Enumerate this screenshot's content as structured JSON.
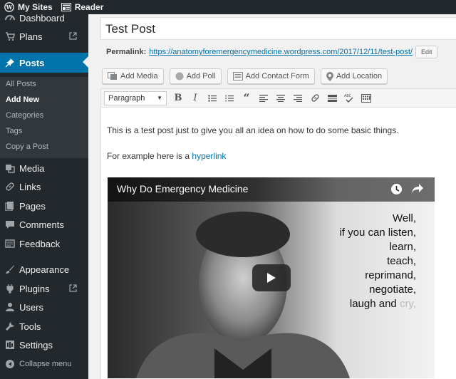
{
  "adminbar": {
    "my_sites": "My Sites",
    "reader": "Reader"
  },
  "sidebar": {
    "items": [
      {
        "label": "Dashboard",
        "icon": "dashboard-icon"
      },
      {
        "label": "Plans",
        "icon": "plans-icon",
        "external": true
      },
      {
        "label": "Posts",
        "icon": "pin-icon",
        "active": true
      },
      {
        "label": "Media",
        "icon": "media-icon"
      },
      {
        "label": "Links",
        "icon": "link-icon"
      },
      {
        "label": "Pages",
        "icon": "pages-icon"
      },
      {
        "label": "Comments",
        "icon": "comment-icon"
      },
      {
        "label": "Feedback",
        "icon": "feedback-icon"
      },
      {
        "label": "Appearance",
        "icon": "brush-icon"
      },
      {
        "label": "Plugins",
        "icon": "plugin-icon",
        "external": true
      },
      {
        "label": "Users",
        "icon": "user-icon"
      },
      {
        "label": "Tools",
        "icon": "wrench-icon"
      },
      {
        "label": "Settings",
        "icon": "settings-icon"
      },
      {
        "label": "Collapse menu",
        "icon": "collapse-icon"
      }
    ],
    "submenu": [
      "All Posts",
      "Add New",
      "Categories",
      "Tags",
      "Copy a Post"
    ],
    "accent": "#0073aa"
  },
  "editor": {
    "title": "Test Post",
    "permalink_label": "Permalink:",
    "permalink_url": "https://anatomyforemergencymedicine.wordpress.com/2017/12/11/test-post/",
    "edit_label": "Edit",
    "media_buttons": [
      "Add Media",
      "Add Poll",
      "Add Contact Form",
      "Add Location"
    ],
    "format_select": "Paragraph",
    "paragraph1": "This is a test post just to give you all an idea on how to do some basic things.",
    "paragraph2_prefix": "For example here is a ",
    "paragraph2_link": "hyperlink"
  },
  "video": {
    "title": "Why Do Emergency Medicine",
    "quote_lines": [
      "Well,",
      "if you can listen,",
      "learn,",
      "teach,",
      "reprimand,",
      "negotiate,",
      "laugh and"
    ],
    "quote_faint": "cry,"
  }
}
